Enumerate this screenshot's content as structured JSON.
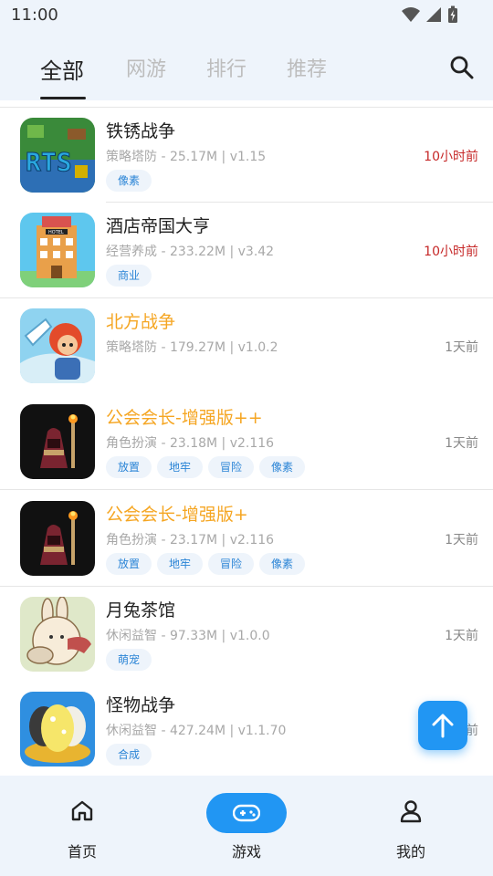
{
  "status": {
    "time": "11:00"
  },
  "tabs": [
    {
      "label": "全部"
    },
    {
      "label": "网游"
    },
    {
      "label": "排行"
    },
    {
      "label": "推荐"
    }
  ],
  "games": [
    {
      "name": "铁锈战争",
      "meta": "策略塔防 - 25.17M | v1.15",
      "time": "10小时前",
      "tags": [
        "像素"
      ]
    },
    {
      "name": "酒店帝国大亨",
      "meta": "经营养成 - 233.22M | v3.42",
      "time": "10小时前",
      "tags": [
        "商业"
      ]
    },
    {
      "name": "北方战争",
      "meta": "策略塔防 - 179.27M | v1.0.2",
      "time": "1天前",
      "tags": []
    },
    {
      "name": "公会会长-增强版++",
      "meta": "角色扮演 - 23.18M | v2.116",
      "time": "1天前",
      "tags": [
        "放置",
        "地牢",
        "冒险",
        "像素"
      ]
    },
    {
      "name": "公会会长-增强版+",
      "meta": "角色扮演 - 23.17M | v2.116",
      "time": "1天前",
      "tags": [
        "放置",
        "地牢",
        "冒险",
        "像素"
      ]
    },
    {
      "name": "月兔茶馆",
      "meta": "休闲益智 - 97.33M | v1.0.0",
      "time": "1天前",
      "tags": [
        "萌宠"
      ]
    },
    {
      "name": "怪物战争",
      "meta": "休闲益智 - 427.24M | v1.1.70",
      "time": "1天前",
      "tags": [
        "合成"
      ]
    }
  ],
  "bottom_nav": [
    {
      "label": "首页",
      "icon": "home-icon"
    },
    {
      "label": "游戏",
      "icon": "gamepad-icon"
    },
    {
      "label": "我的",
      "icon": "person-icon"
    }
  ],
  "colors": {
    "accent": "#2196f3",
    "highlight_name": "#f5a623",
    "recent_time": "#c62828",
    "tag_text": "#2a84d6",
    "tag_bg": "#eef4fb"
  }
}
